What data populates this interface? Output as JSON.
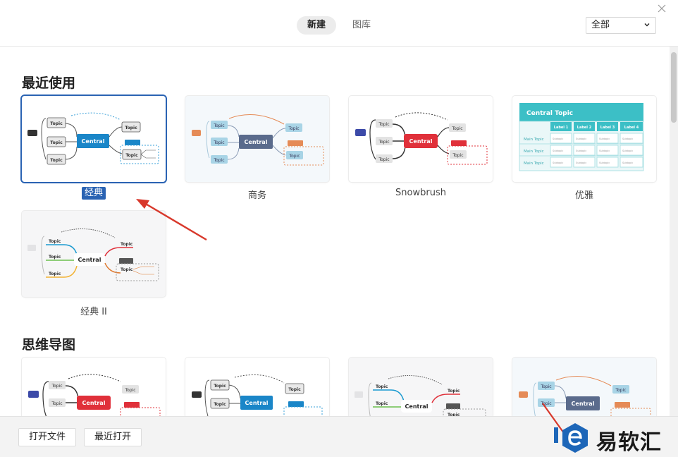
{
  "header": {
    "tabs": [
      {
        "label": "新建",
        "active": true
      },
      {
        "label": "图库",
        "active": false
      }
    ],
    "filter": {
      "selected": "全部"
    }
  },
  "sections": {
    "recent": {
      "title": "最近使用",
      "items": [
        {
          "label": "经典",
          "selected": true
        },
        {
          "label": "商务"
        },
        {
          "label": "Snowbrush"
        },
        {
          "label": "优雅"
        },
        {
          "label": "经典 II"
        }
      ]
    },
    "mindmap": {
      "title": "思维导图"
    }
  },
  "preview": {
    "central": "Central",
    "topic": "Topic",
    "central_topic": "Central Topic",
    "main_topic": "Main Topic",
    "label1": "Label 1",
    "label2": "Label 2",
    "label3": "Label 3",
    "label4": "Label 4",
    "subtopic": "Subtopic"
  },
  "footer": {
    "open_file": "打开文件",
    "recent_open": "最近打开"
  },
  "watermark": {
    "text": "易软汇"
  },
  "colors": {
    "selected": "#2a63b3",
    "classic_central": "#1a86c8",
    "business_central": "#5a6b8c",
    "snowbrush_central": "#e0303a",
    "elegant_header": "#3cbfc6",
    "annotation": "#d8382b"
  }
}
